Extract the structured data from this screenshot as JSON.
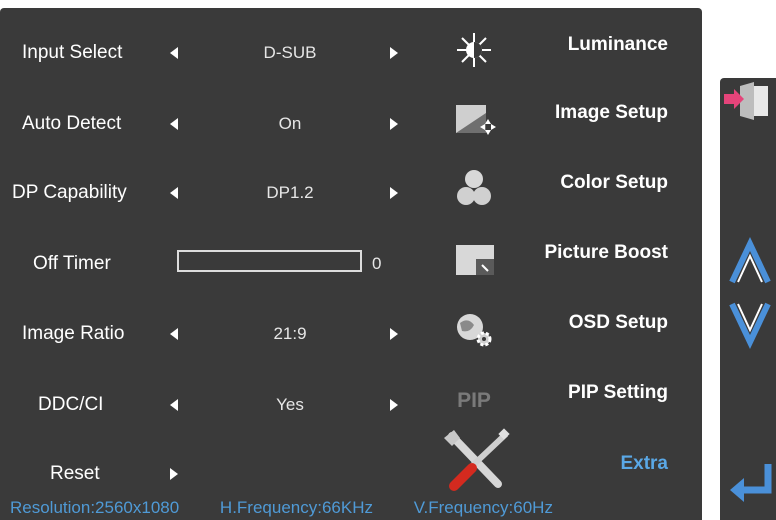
{
  "settings": [
    {
      "label": "Input Select",
      "value": "D-SUB"
    },
    {
      "label": "Auto Detect",
      "value": "On"
    },
    {
      "label": "DP Capability",
      "value": "DP1.2"
    },
    {
      "label": "Off Timer",
      "value": "0",
      "progress": 0
    },
    {
      "label": "Image Ratio",
      "value": "21:9"
    },
    {
      "label": "DDC/CI",
      "value": "Yes"
    },
    {
      "label": "Reset"
    }
  ],
  "menu": [
    {
      "label": "Luminance",
      "icon": "brightness-icon"
    },
    {
      "label": "Image Setup",
      "icon": "image-setup-icon"
    },
    {
      "label": "Color Setup",
      "icon": "color-setup-icon"
    },
    {
      "label": "Picture Boost",
      "icon": "picture-boost-icon"
    },
    {
      "label": "OSD Setup",
      "icon": "osd-setup-icon"
    },
    {
      "label": "PIP Setting",
      "icon": "pip-icon",
      "icon_text": "PIP"
    },
    {
      "label": "Extra",
      "icon": "tools-icon",
      "active": true
    }
  ],
  "status": {
    "resolution": "Resolution:2560x1080",
    "hfreq": "H.Frequency:66KHz",
    "vfreq": "V.Frequency:60Hz"
  },
  "side_buttons": [
    "exit-icon",
    "up-arrow-icon",
    "down-arrow-icon",
    "enter-icon"
  ],
  "colors": {
    "panel": "#3a3a3a",
    "active": "#5aa8e6",
    "status": "#4f9ad6",
    "side_arrows": "#4a90d9"
  }
}
